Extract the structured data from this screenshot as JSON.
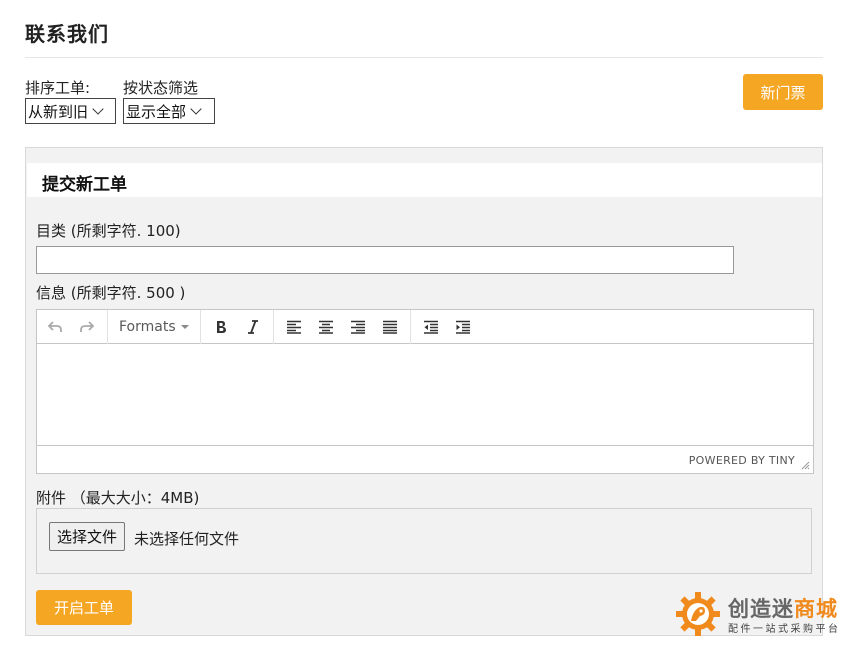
{
  "page": {
    "title": "联系我们"
  },
  "filters": {
    "sort_label": "排序工单:",
    "sort_value": "从新到旧",
    "status_label": "按状态筛选",
    "status_value": "显示全部"
  },
  "new_ticket_button": "新门票",
  "form": {
    "header": "提交新工单",
    "subject_label": "目类 (所剩字符. 100)",
    "subject_value": "",
    "message_label": "信息 (所剩字符. 500 )",
    "editor": {
      "formats_label": "Formats",
      "powered_by": "POWERED BY TINY",
      "icons": [
        "undo-icon",
        "redo-icon",
        "bold-icon",
        "italic-icon",
        "align-left-icon",
        "align-center-icon",
        "align-right-icon",
        "align-justify-icon",
        "outdent-icon",
        "indent-icon"
      ]
    },
    "attachment_label": "附件 （最大大小：4MB)",
    "file_button": "选择文件",
    "file_status": "未选择任何文件",
    "submit_button": "开启工单"
  },
  "watermark": {
    "name_part1": "创造迷",
    "name_part2": "商城",
    "tagline": "配件一站式采购平台",
    "accent": "#f08a1c"
  },
  "colors": {
    "accent": "#f5a623",
    "panel_bg": "#f2f2f2"
  }
}
